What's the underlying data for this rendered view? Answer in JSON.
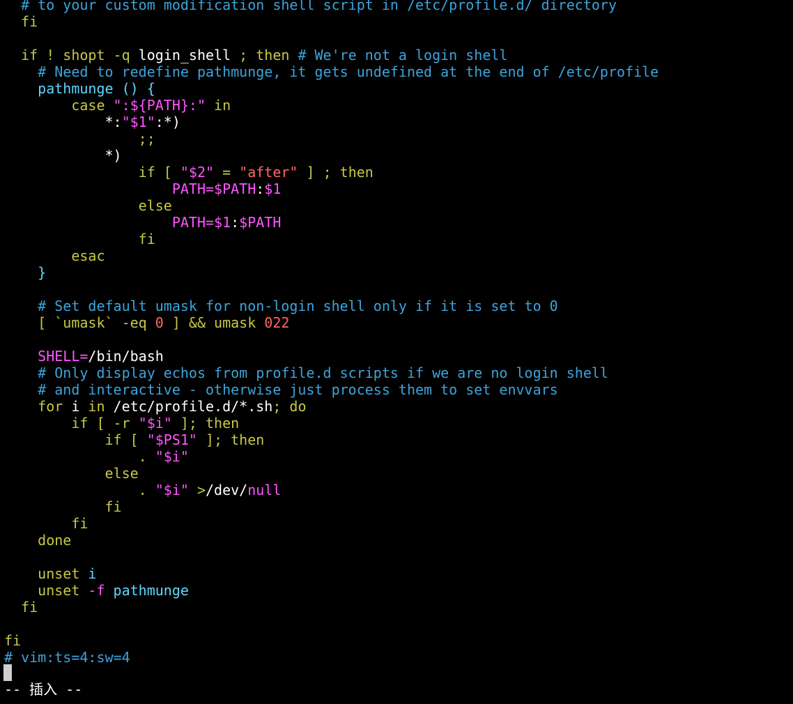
{
  "colors": {
    "default": "#ffffff",
    "comment": "#3da4dc",
    "statement": "#c8c848",
    "string": "#ff55ff",
    "constant": "#ff6666",
    "function": "#5fd7ff",
    "background": "#000000"
  },
  "editor": {
    "lines": [
      [
        [
          "c",
          "  # to your custom modification shell script in /etc/profile.d/ directory"
        ]
      ],
      [
        [
          "k",
          "  fi"
        ]
      ],
      [],
      [
        [
          "k",
          "  if ! shopt -q "
        ],
        [
          "d",
          "login_shell"
        ],
        [
          "k",
          " ; then "
        ],
        [
          "c",
          "# We're not a login shell"
        ]
      ],
      [
        [
          "c",
          "    # Need to redefine pathmunge, it gets undefined at the end of /etc/profile"
        ]
      ],
      [
        [
          "f",
          "    pathmunge () {"
        ]
      ],
      [
        [
          "k",
          "        case "
        ],
        [
          "s",
          "\":${PATH}:\""
        ],
        [
          "k",
          " in"
        ]
      ],
      [
        [
          "k",
          "            "
        ],
        [
          "d",
          "*:"
        ],
        [
          "s",
          "\"$1\""
        ],
        [
          "d",
          ":*)"
        ]
      ],
      [
        [
          "k",
          "                ;;"
        ]
      ],
      [
        [
          "d",
          "            *)"
        ]
      ],
      [
        [
          "k",
          "                if [ "
        ],
        [
          "s",
          "\"$2\""
        ],
        [
          "k",
          " = "
        ],
        [
          "n",
          "\"after\""
        ],
        [
          "k",
          " ] ; then"
        ]
      ],
      [
        [
          "s",
          "                    PATH=$PATH"
        ],
        [
          "d",
          ":"
        ],
        [
          "s",
          "$1"
        ]
      ],
      [
        [
          "k",
          "                else"
        ]
      ],
      [
        [
          "s",
          "                    PATH=$1"
        ],
        [
          "d",
          ":"
        ],
        [
          "s",
          "$PATH"
        ]
      ],
      [
        [
          "k",
          "                fi"
        ]
      ],
      [
        [
          "k",
          "        esac"
        ]
      ],
      [
        [
          "f",
          "    }"
        ]
      ],
      [],
      [
        [
          "c",
          "    # Set default umask for non-login shell only if it is set to 0"
        ]
      ],
      [
        [
          "k",
          "    [ `umask` -eq "
        ],
        [
          "n",
          "0"
        ],
        [
          "k",
          " ] && umask "
        ],
        [
          "n",
          "022"
        ]
      ],
      [],
      [
        [
          "s",
          "    SHELL="
        ],
        [
          "d",
          "/bin/bash"
        ]
      ],
      [
        [
          "c",
          "    # Only display echos from profile.d scripts if we are no login shell"
        ]
      ],
      [
        [
          "c",
          "    # and interactive - otherwise just process them to set envvars"
        ]
      ],
      [
        [
          "k",
          "    for "
        ],
        [
          "d",
          "i"
        ],
        [
          "k",
          " in "
        ],
        [
          "d",
          "/etc/profile.d/*.sh"
        ],
        [
          "k",
          "; do"
        ]
      ],
      [
        [
          "k",
          "        if [ -r "
        ],
        [
          "s",
          "\"$i\""
        ],
        [
          "k",
          " ]; then"
        ]
      ],
      [
        [
          "k",
          "            if [ "
        ],
        [
          "s",
          "\"$PS1\""
        ],
        [
          "k",
          " ]; then"
        ]
      ],
      [
        [
          "k",
          "                . "
        ],
        [
          "s",
          "\"$i\""
        ]
      ],
      [
        [
          "k",
          "            else"
        ]
      ],
      [
        [
          "k",
          "                . "
        ],
        [
          "s",
          "\"$i\""
        ],
        [
          "k",
          " >"
        ],
        [
          "d",
          "/dev/"
        ],
        [
          "s",
          "null"
        ]
      ],
      [
        [
          "k",
          "            fi"
        ]
      ],
      [
        [
          "k",
          "        fi"
        ]
      ],
      [
        [
          "k",
          "    done"
        ]
      ],
      [],
      [
        [
          "k",
          "    unset "
        ],
        [
          "f",
          "i"
        ]
      ],
      [
        [
          "k",
          "    unset "
        ],
        [
          "s",
          "-f "
        ],
        [
          "f",
          "pathmunge"
        ]
      ],
      [
        [
          "k",
          "  fi"
        ]
      ],
      [],
      [
        [
          "k",
          "fi"
        ]
      ],
      [
        [
          "c",
          "# vim:ts=4:sw=4"
        ]
      ]
    ]
  },
  "status": {
    "mode_text": "-- 插入 --"
  }
}
